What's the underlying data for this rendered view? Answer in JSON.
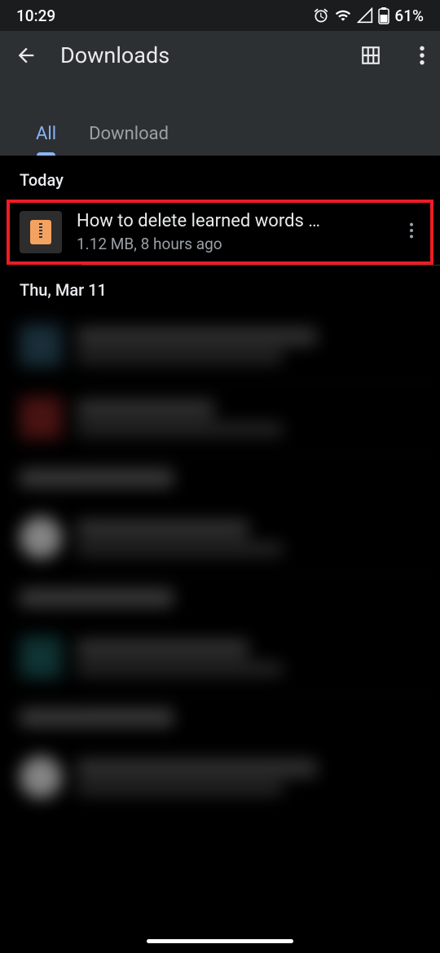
{
  "status": {
    "time": "10:29",
    "battery": "61%"
  },
  "header": {
    "title": "Downloads"
  },
  "tabs": {
    "all": "All",
    "download": "Download"
  },
  "sections": {
    "today": "Today",
    "thu_mar_11": "Thu, Mar 11"
  },
  "files": {
    "item1": {
      "name": "How to delete learned words …",
      "meta": "1.12 MB, 8 hours ago"
    }
  }
}
